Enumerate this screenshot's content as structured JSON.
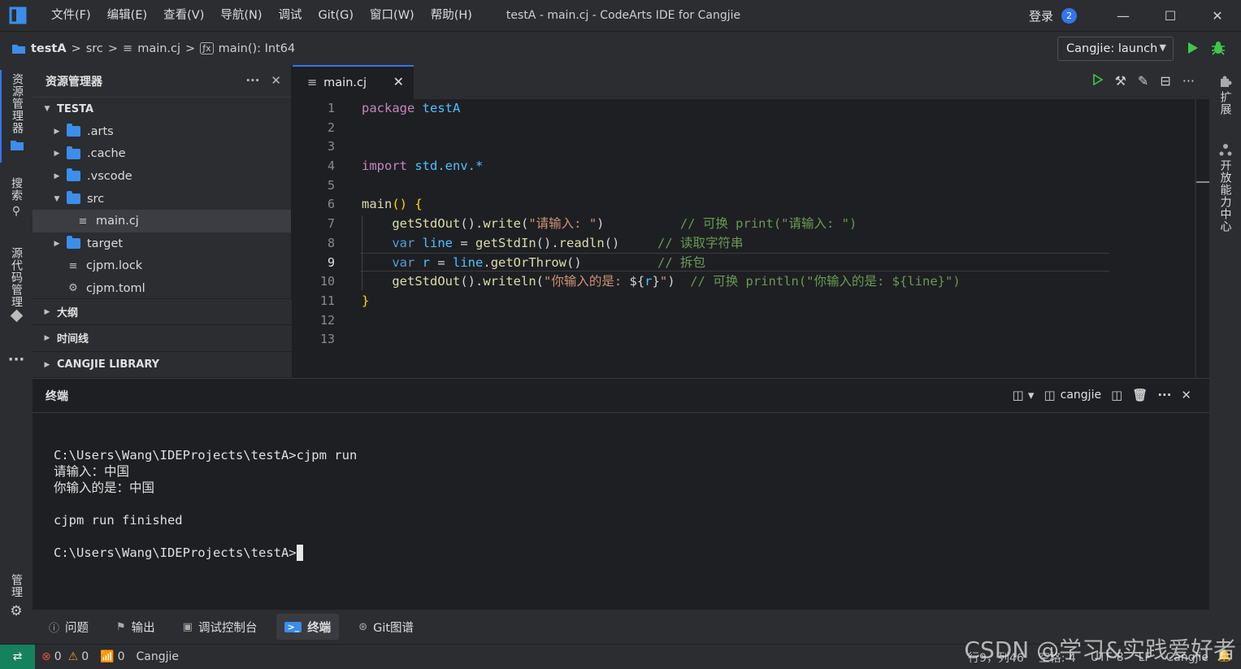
{
  "window": {
    "title": "testA - main.cj - CodeArts IDE for Cangjie",
    "menu": [
      "文件(F)",
      "编辑(E)",
      "查看(V)",
      "导航(N)",
      "调试",
      "Git(G)",
      "窗口(W)",
      "帮助(H)"
    ],
    "login_label": "登录",
    "notification_count": "2"
  },
  "breadcrumb": {
    "project": "testA",
    "folder": "src",
    "file": "main.cj",
    "symbol": "main(): Int64"
  },
  "run_config": {
    "label": "Cangjie: launch"
  },
  "activity_left": {
    "explorer": "资源管理器",
    "search": "搜索",
    "source_control": "源代码管理",
    "manage": "管理"
  },
  "activity_right": {
    "extensions": "扩展",
    "open_center": "开放能力中心"
  },
  "explorer": {
    "title": "资源管理器",
    "root": "TESTA",
    "items": [
      {
        "label": ".arts",
        "kind": "folder",
        "expanded": false
      },
      {
        "label": ".cache",
        "kind": "folder",
        "expanded": false
      },
      {
        "label": ".vscode",
        "kind": "folder",
        "expanded": false
      },
      {
        "label": "src",
        "kind": "folder",
        "expanded": true
      },
      {
        "label": "main.cj",
        "kind": "file",
        "selected": true
      },
      {
        "label": "target",
        "kind": "folder",
        "expanded": false
      },
      {
        "label": "cjpm.lock",
        "kind": "file"
      },
      {
        "label": "cjpm.toml",
        "kind": "gear-file"
      }
    ],
    "sections": [
      "大纲",
      "时间线",
      "CANGJIE LIBRARY"
    ]
  },
  "editor": {
    "tab_label": "main.cj",
    "line_numbers": [
      "1",
      "2",
      "3",
      "4",
      "5",
      "6",
      "7",
      "8",
      "9",
      "10",
      "11",
      "12",
      "13"
    ],
    "current_line": 9
  },
  "panel": {
    "title": "终端",
    "shell_label": "cangjie",
    "terminal_lines": [
      "C:\\Users\\Wang\\IDEProjects\\testA>cjpm run",
      "请输入：中国",
      "你输入的是：中国",
      "",
      "cjpm run finished",
      "",
      "C:\\Users\\Wang\\IDEProjects\\testA>"
    ]
  },
  "tool_tabs": [
    {
      "label": "问题",
      "icon": "info-icon"
    },
    {
      "label": "输出",
      "icon": "flag-icon"
    },
    {
      "label": "调试控制台",
      "icon": "debug-console-icon"
    },
    {
      "label": "终端",
      "icon": "terminal-icon",
      "active": true
    },
    {
      "label": "Git图谱",
      "icon": "git-graph-icon"
    }
  ],
  "status": {
    "errors": "0",
    "warnings": "0",
    "broadcast": "0",
    "language": "Cangjie",
    "position": "行9，列46",
    "indent": "空格: 4",
    "encoding": "UTF-8",
    "eol": "LF",
    "mode": "Cangjie"
  },
  "watermark": "CSDN @学习&实践爱好者",
  "colors": {
    "accent": "#3574f0",
    "remote": "#16825d",
    "run": "#3ec74b"
  }
}
